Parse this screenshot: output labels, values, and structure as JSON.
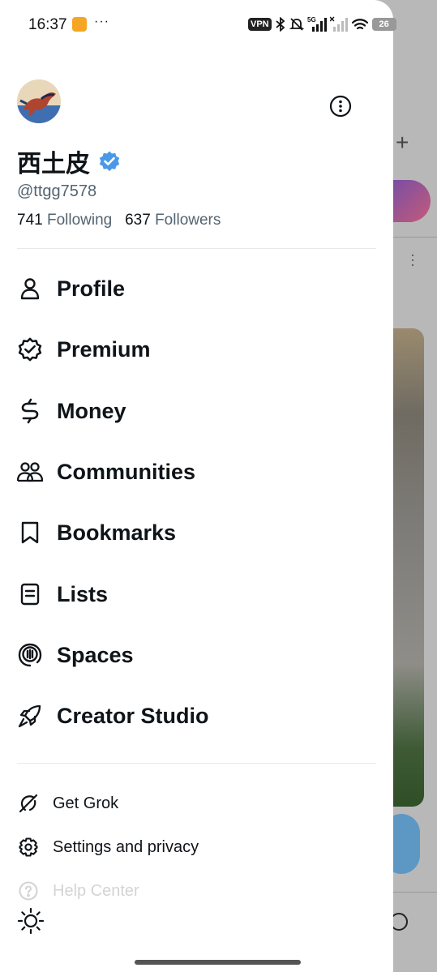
{
  "status_bar": {
    "time": "16:37",
    "more": "···",
    "vpn": "VPN",
    "network": "5G",
    "battery": "26"
  },
  "profile": {
    "display_name": "西土皮",
    "verified": true,
    "handle": "@ttgg7578",
    "following_count": "741",
    "following_label": "Following",
    "followers_count": "637",
    "followers_label": "Followers"
  },
  "nav": {
    "items": [
      {
        "label": "Profile",
        "icon": "person-icon"
      },
      {
        "label": "Premium",
        "icon": "verified-badge-icon"
      },
      {
        "label": "Money",
        "icon": "money-icon"
      },
      {
        "label": "Communities",
        "icon": "communities-icon"
      },
      {
        "label": "Bookmarks",
        "icon": "bookmark-icon"
      },
      {
        "label": "Lists",
        "icon": "lists-icon"
      },
      {
        "label": "Spaces",
        "icon": "spaces-icon"
      },
      {
        "label": "Creator Studio",
        "icon": "rocket-icon"
      }
    ]
  },
  "secondary": {
    "items": [
      {
        "label": "Get Grok",
        "icon": "grok-icon"
      },
      {
        "label": "Settings and privacy",
        "icon": "gear-icon"
      },
      {
        "label": "Help Center",
        "icon": "help-icon"
      }
    ]
  },
  "colors": {
    "verified_blue": "#4a99e9",
    "text_primary": "#0f1419",
    "text_secondary": "#536471"
  }
}
